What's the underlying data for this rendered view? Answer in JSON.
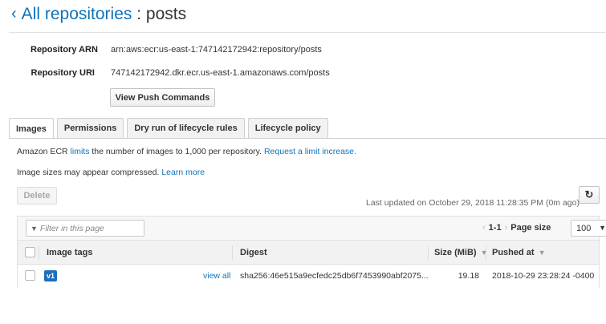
{
  "header": {
    "back_chevron": "‹",
    "repo_link": "All repositories",
    "separator": " : ",
    "repo_name": "posts"
  },
  "details": {
    "arn_label": "Repository ARN",
    "arn_value": "arn:aws:ecr:us-east-1:747142172942:repository/posts",
    "uri_label": "Repository URI",
    "uri_value": "747142172942.dkr.ecr.us-east-1.amazonaws.com/posts",
    "push_button": "View Push Commands"
  },
  "tabs": [
    {
      "label": "Images",
      "active": true
    },
    {
      "label": "Permissions",
      "active": false
    },
    {
      "label": "Dry run of lifecycle rules",
      "active": false
    },
    {
      "label": "Lifecycle policy",
      "active": false
    }
  ],
  "info": {
    "limit_prefix": "Amazon ECR ",
    "limit_link": "limits",
    "limit_mid": " the number of images to 1,000 per repository. ",
    "limit_request": "Request a limit increase.",
    "compress_text": "Image sizes may appear compressed. ",
    "learn_more": "Learn more"
  },
  "actions": {
    "delete_button": "Delete",
    "last_updated": "Last updated on October 29, 2018 11:28:35 PM (0m ago)",
    "refresh_icon": "refresh-icon"
  },
  "table": {
    "filter_placeholder": "Filter in this page",
    "pager_range": "1-1",
    "page_size_label": "Page size",
    "page_size_value": "100",
    "columns": [
      "Image tags",
      "Digest",
      "Size (MiB)",
      "Pushed at"
    ],
    "rows": [
      {
        "tag": "v1",
        "view_all": "view all",
        "digest": "sha256:46e515a9ecfedc25db6f7453990abf2075...",
        "size": "19.18",
        "pushed_at": "2018-10-29 23:28:24 -0400"
      }
    ]
  },
  "colors": {
    "link": "#0f73ba",
    "tag_badge": "#1d6fb8"
  }
}
